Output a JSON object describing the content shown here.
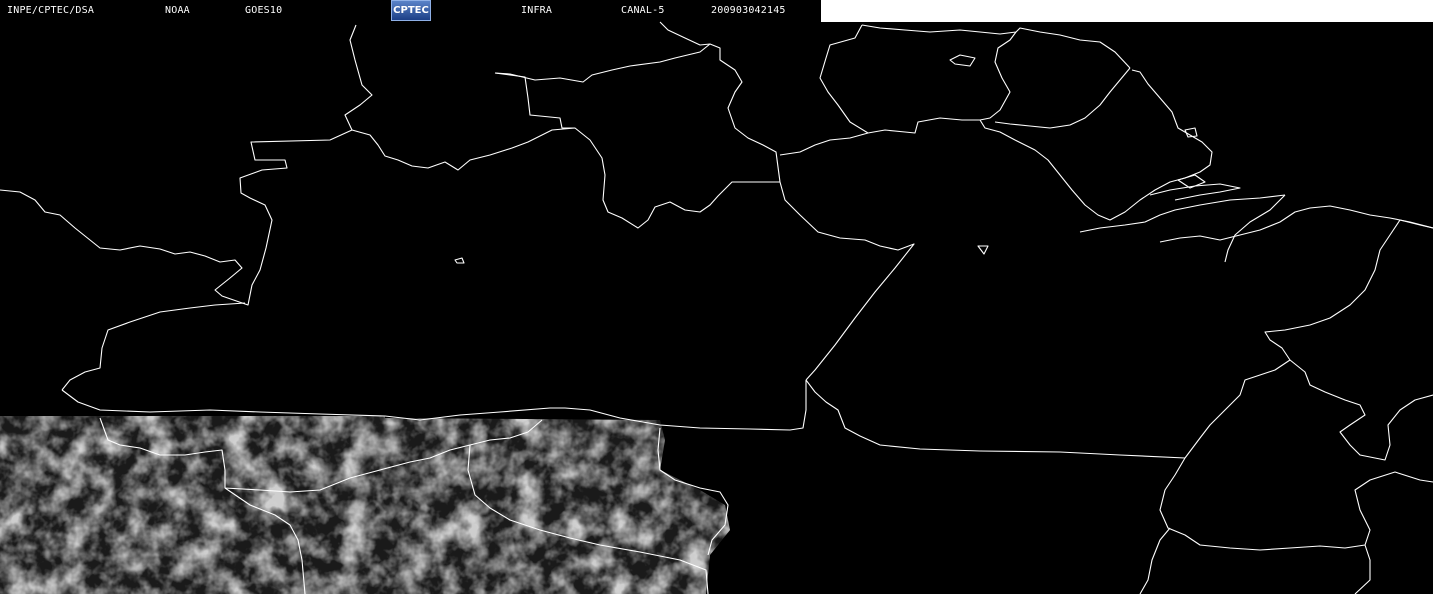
{
  "header": {
    "source": "INPE/CPTEC/DSA",
    "agency": "NOAA",
    "satellite": "GOES10",
    "logo_text": "CPTEC",
    "band": "INFRA",
    "channel": "CANAL-5",
    "datetime": "200903042145"
  },
  "colors": {
    "background": "#000000",
    "borders": "#ffffff",
    "cloud_gray": "#9a9a9a",
    "header_text": "#ffffff"
  }
}
